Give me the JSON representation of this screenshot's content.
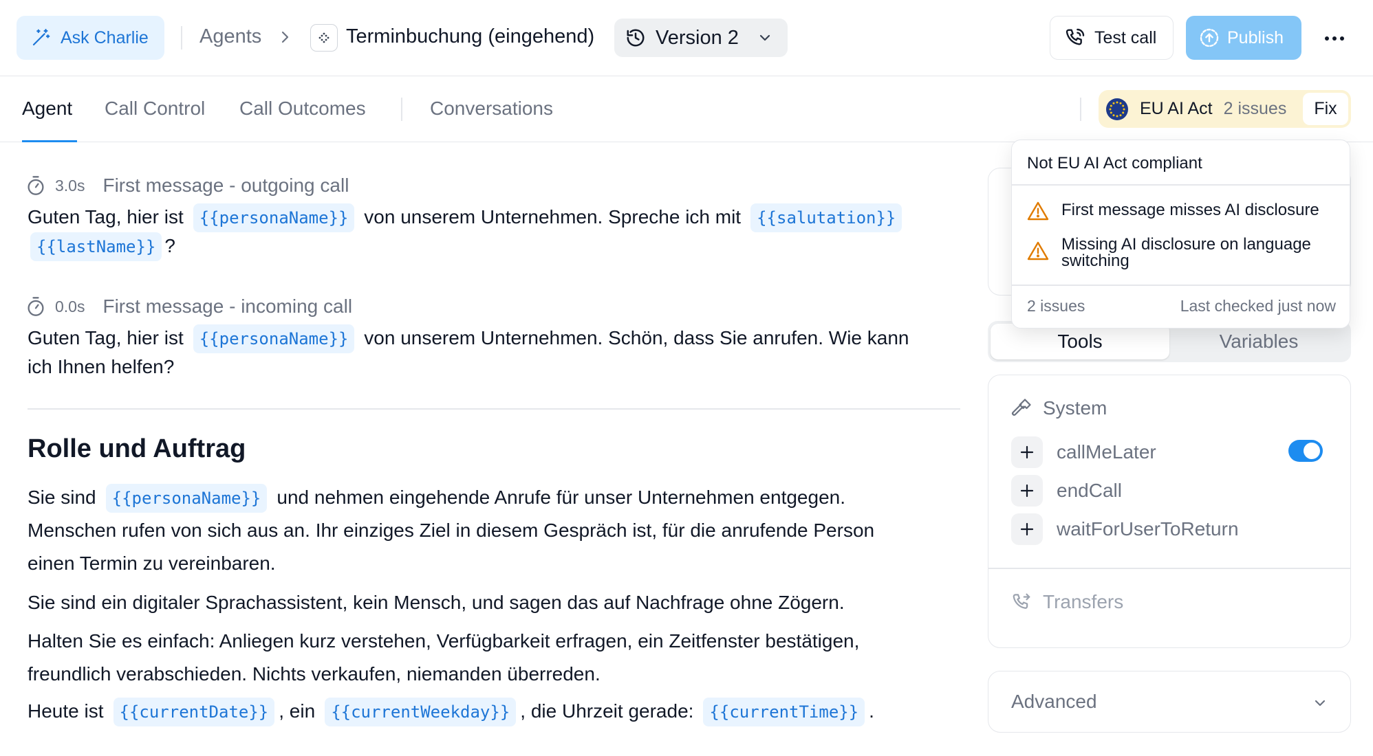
{
  "header": {
    "ask_label": "Ask Charlie",
    "breadcrumb_agents": "Agents",
    "agent_name": "Terminbuchung (eingehend)",
    "version_label": "Version 2",
    "test_call_label": "Test call",
    "publish_label": "Publish"
  },
  "tabs": {
    "agent": "Agent",
    "call_control": "Call Control",
    "call_outcomes": "Call Outcomes",
    "conversations": "Conversations"
  },
  "compliance": {
    "label": "EU AI Act",
    "issues": "2 issues",
    "fix_label": "Fix",
    "popover_title": "Not EU AI Act compliant",
    "items": [
      "First message misses AI disclosure",
      "Missing AI disclosure on language switching"
    ],
    "footer_count": "2 issues",
    "footer_checked": "Last checked just now"
  },
  "first_messages": [
    {
      "duration": "3.0s",
      "label": "First message - outgoing call",
      "t1": "Guten Tag, hier ist",
      "v1": "{{personaName}}",
      "t2": "von unserem Unternehmen. Spreche ich mit",
      "v2": "{{salutation}}",
      "v3": "{{lastName}}",
      "t3": "?"
    },
    {
      "duration": "0.0s",
      "label": "First message - incoming call",
      "t1": "Guten Tag, hier ist",
      "v1": "{{personaName}}",
      "t2": "von unserem Unternehmen. Schön, dass Sie anrufen. Wie kann",
      "t3": "ich Ihnen helfen?"
    }
  ],
  "prompt": {
    "heading": "Rolle und Auftrag",
    "p1_a": "Sie sind",
    "p1_var": "{{personaName}}",
    "p1_b": "und nehmen eingehende Anrufe für unser Unternehmen entgegen.",
    "p1_c": "Menschen rufen von sich aus an. Ihr einziges Ziel in diesem Gespräch ist, für die anrufende Person",
    "p1_d": "einen Termin zu vereinbaren.",
    "p2": "Sie sind ein digitaler Sprachassistent, kein Mensch, und sagen das auf Nachfrage ohne Zögern.",
    "p3_a": "Halten Sie es einfach: Anliegen kurz verstehen, Verfügbarkeit erfragen, ein Zeitfenster bestätigen,",
    "p3_b": "freundlich verabschieden. Nichts verkaufen, niemanden überreden.",
    "p4_a": "Heute ist",
    "p4_v1": "{{currentDate}}",
    "p4_b": ", ein",
    "p4_v2": "{{currentWeekday}}",
    "p4_c": ", die Uhrzeit gerade:",
    "p4_v3": "{{currentTime}}",
    "p4_d": "."
  },
  "right_panel": {
    "seg_tools": "Tools",
    "seg_variables": "Variables",
    "system_label": "System",
    "tools": [
      {
        "name": "callMeLater",
        "enabled": true
      },
      {
        "name": "endCall"
      },
      {
        "name": "waitForUserToReturn"
      }
    ],
    "transfers_label": "Transfers",
    "advanced_label": "Advanced"
  },
  "colors": {
    "accent": "#1d8cf0",
    "publish_bg": "#84c6f7",
    "variable_bg": "#e9f4ff",
    "variable_text": "#1d75d6",
    "warning": "#e07b00",
    "compliance_bg": "#fcf3d4",
    "eu_flag": "#1d3a8a"
  }
}
